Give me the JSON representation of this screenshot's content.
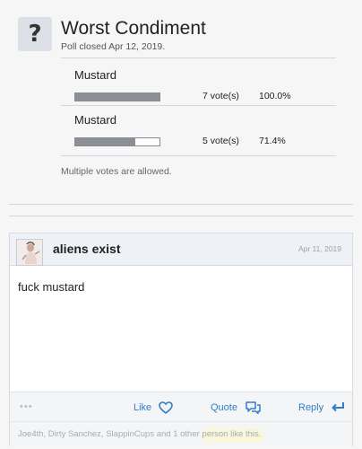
{
  "poll": {
    "icon_glyph": "?",
    "title": "Worst Condiment",
    "status": "Poll closed Apr 12, 2019.",
    "options": [
      {
        "label": "Mustard",
        "votes_text": "7 vote(s)",
        "percent_text": "100.0%",
        "fraction": 1.0
      },
      {
        "label": "Mustard",
        "votes_text": "5 vote(s)",
        "percent_text": "71.4%",
        "fraction": 0.714
      }
    ],
    "multiple_note": "Multiple votes are allowed."
  },
  "post": {
    "username": "aliens exist",
    "date": "Apr 11, 2019",
    "body": "fuck mustard",
    "more_glyph": "•••",
    "actions": {
      "like": "Like",
      "quote": "Quote",
      "reply": "Reply"
    },
    "likes_text": "Joe4th, Dirty Sanchez, SlappinCups and 1 other person like this."
  },
  "colors": {
    "accent": "#2f7fc7",
    "bar_fill": "#8c9096",
    "background": "#f6f6f7"
  },
  "icons": [
    "question-icon",
    "heart-icon",
    "quote-bubble-icon",
    "reply-arrow-icon"
  ]
}
